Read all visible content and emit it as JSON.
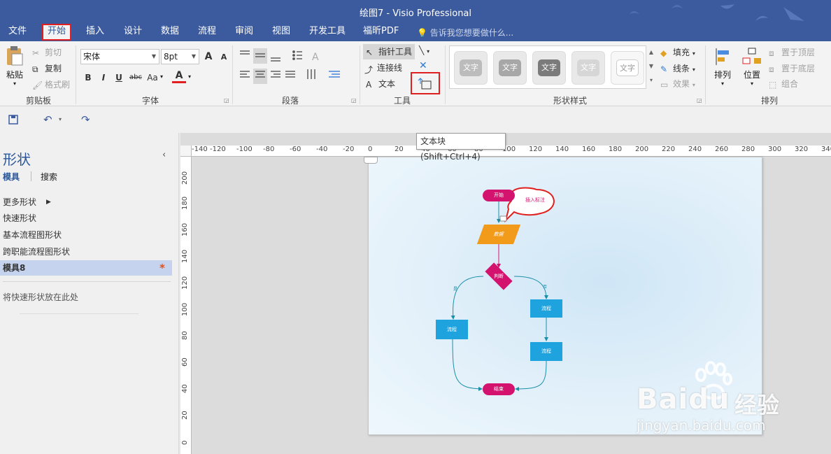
{
  "window": {
    "title": "绘图7 - Visio Professional"
  },
  "menu": {
    "tabs": [
      "文件",
      "开始",
      "插入",
      "设计",
      "数据",
      "流程",
      "审阅",
      "视图",
      "开发工具",
      "福昕PDF"
    ],
    "active_tab": "开始",
    "tell_me": "告诉我您想要做什么..."
  },
  "ribbon": {
    "clipboard": {
      "paste": "粘贴",
      "cut": "剪切",
      "copy": "复制",
      "format_painter": "格式刷",
      "label": "剪贴板"
    },
    "font": {
      "name": "宋体",
      "size": "8pt",
      "grow": "A",
      "shrink": "A",
      "bold": "B",
      "italic": "I",
      "underline": "U",
      "strike": "abc",
      "case": "Aa",
      "color": "A",
      "label": "字体"
    },
    "paragraph": {
      "label": "段落"
    },
    "tools": {
      "pointer": "指针工具",
      "connector": "连接线",
      "text": "文本",
      "label": "工具"
    },
    "shape_styles": {
      "tiles": [
        "文字",
        "文字",
        "文字",
        "文字",
        "文字"
      ],
      "fill": "填充",
      "line": "线条",
      "effects": "效果",
      "label": "形状样式"
    },
    "arrange": {
      "arrange": "排列",
      "position": "位置",
      "bring_front": "置于顶层",
      "send_back": "置于底层",
      "group": "组合",
      "label": "排列"
    }
  },
  "tooltip": {
    "text": "文本块 (Shift+Ctrl+4)"
  },
  "sidebar": {
    "title": "形状",
    "tabs": [
      "模具",
      "搜索"
    ],
    "items": [
      "更多形状",
      "快速形状",
      "基本流程图形状",
      "跨职能流程图形状",
      "模具8"
    ],
    "drop_hint": "将快速形状放在此处"
  },
  "ruler": {
    "h_labels": [
      "-140",
      "-120",
      "-100",
      "-80",
      "-60",
      "-40",
      "-20",
      "0",
      "20",
      "40",
      "60",
      "80",
      "100",
      "120",
      "140",
      "160",
      "180",
      "200",
      "220",
      "240",
      "260",
      "280",
      "300",
      "320",
      "340"
    ],
    "v_labels": [
      "200",
      "180",
      "160",
      "140",
      "120",
      "100",
      "80",
      "60",
      "40",
      "20",
      "0"
    ]
  },
  "diagram": {
    "start": "开始",
    "callout": "插入标注",
    "data": "数据",
    "decision": "判断",
    "left_process": "流程",
    "right_process_1": "流程",
    "right_process_2": "流程",
    "end": "结束",
    "branch_yes": "是",
    "branch_no": "否"
  },
  "watermark": {
    "brand": "Baidu",
    "brand_cn": "经验",
    "url": "jingyan.baidu.com"
  },
  "colors": {
    "title_bar": "#3c5b9f",
    "accent": "#2b579a",
    "highlight_box": "#e02020",
    "magenta": "#d4136f",
    "orange": "#f29a1a",
    "process_blue": "#1ea3df"
  }
}
